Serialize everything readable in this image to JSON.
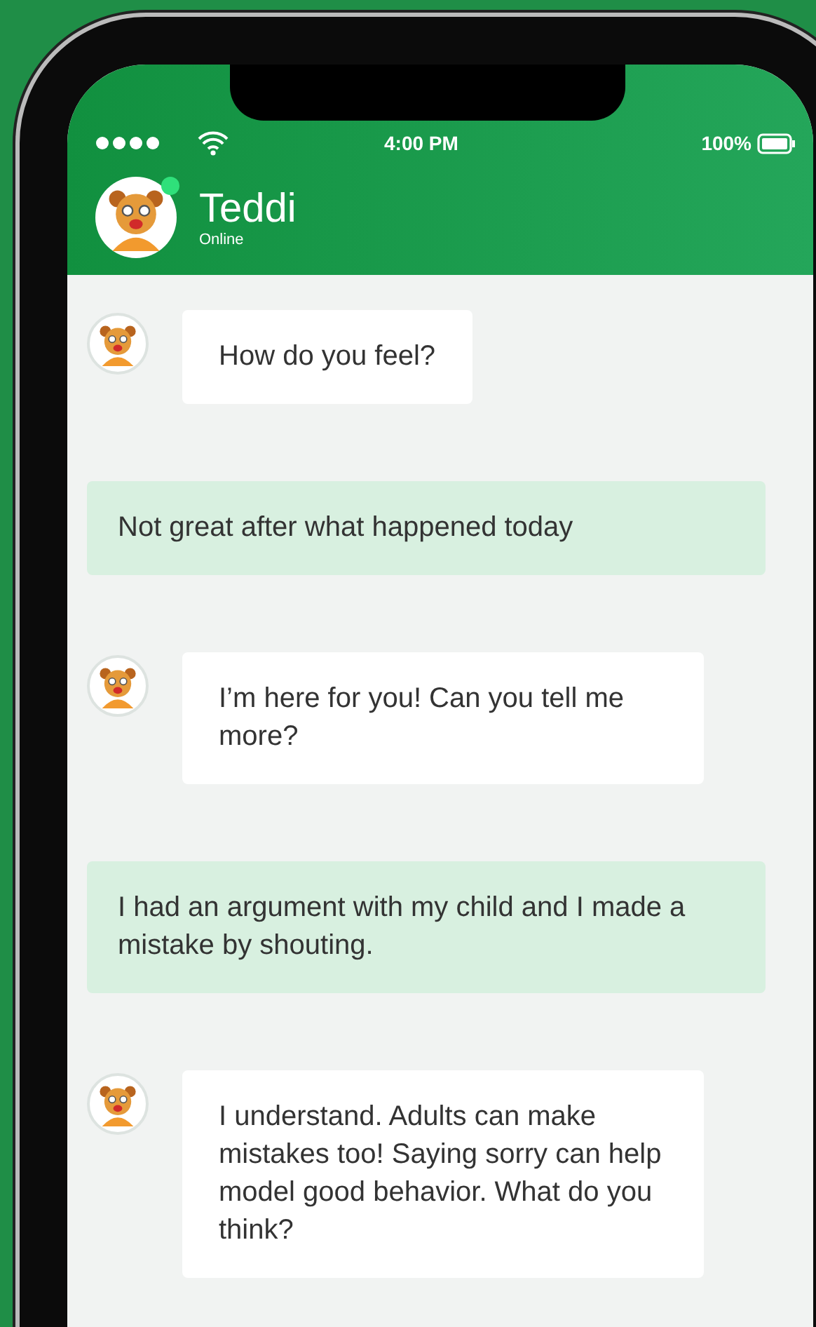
{
  "status_bar": {
    "time": "4:00 PM",
    "battery": "100%"
  },
  "contact": {
    "name": "Teddi",
    "status": "Online",
    "online": true
  },
  "messages": [
    {
      "kind": "bot",
      "text": "How do you feel?"
    },
    {
      "kind": "user",
      "text": "Not great after what happened today"
    },
    {
      "kind": "bot",
      "text": "I’m here for you! Can you tell me more?"
    },
    {
      "kind": "user",
      "text": "I had an argument with my child and I made a mistake by shouting."
    },
    {
      "kind": "bot",
      "text": "I understand. Adults can make mistakes too! Saying sorry can help model good behavior. What do you think?"
    }
  ]
}
